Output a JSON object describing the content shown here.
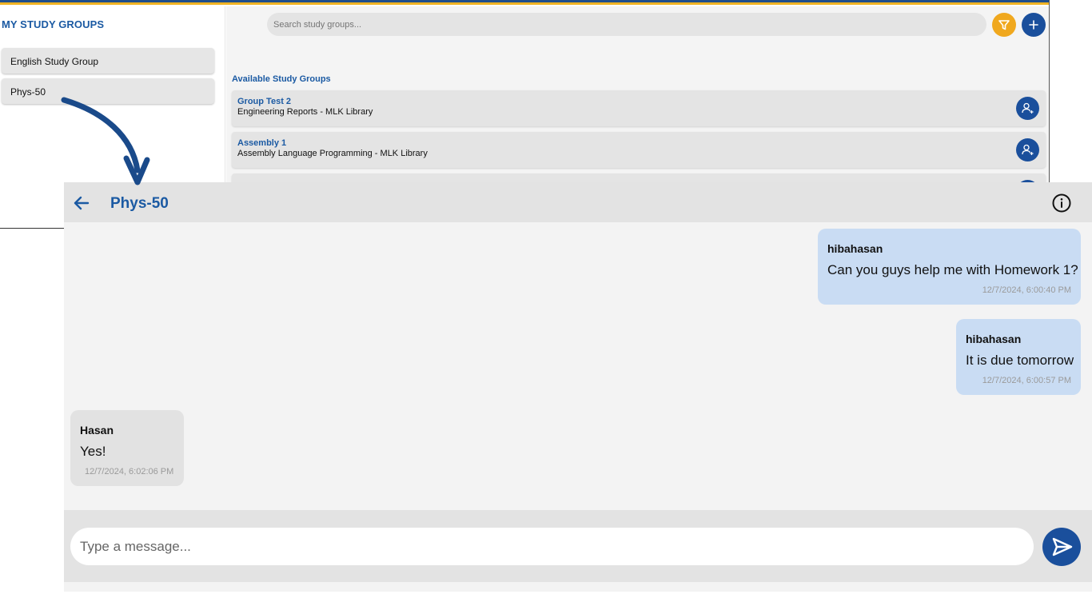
{
  "app": {
    "accent_color": "#1b5aa3",
    "button_color": "#1a4f9c",
    "filter_color": "#f0a81e"
  },
  "sidebar": {
    "title": "MY STUDY GROUPS",
    "items": [
      {
        "label": "English Study Group"
      },
      {
        "label": "Phys-50"
      }
    ]
  },
  "search": {
    "placeholder": "Search study groups...",
    "value": ""
  },
  "toolbar": {
    "filter_icon": "filter-icon",
    "add_icon": "plus-icon"
  },
  "available": {
    "title": "Available Study Groups",
    "groups": [
      {
        "name": "Group Test 2",
        "description": "Engineering Reports - MLK Library",
        "action_icon": "add-user-icon"
      },
      {
        "name": "Assembly 1",
        "description": "Assembly Language Programming - MLK Library",
        "action_icon": "add-user-icon"
      }
    ]
  },
  "chat": {
    "title": "Phys-50",
    "back_icon": "arrow-left-icon",
    "info_icon": "info-icon",
    "messages": [
      {
        "sender": "hibahasan",
        "text": "Can you guys help me with Homework 1?",
        "time": "12/7/2024, 6:00:40 PM",
        "mine": true
      },
      {
        "sender": "hibahasan",
        "text": "It is due tomorrow",
        "time": "12/7/2024, 6:00:57 PM",
        "mine": true
      },
      {
        "sender": "Hasan",
        "text": "Yes!",
        "time": "12/7/2024, 6:02:06 PM",
        "mine": false
      }
    ],
    "composer": {
      "placeholder": "Type a message...",
      "value": "",
      "send_icon": "send-icon"
    }
  }
}
